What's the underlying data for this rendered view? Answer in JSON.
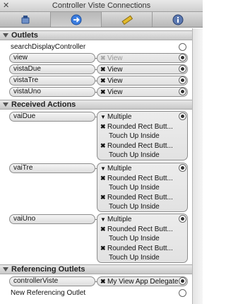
{
  "window": {
    "title": "Controller Viste Connections",
    "close_glyph": "✕"
  },
  "toolbar": {
    "tabs": [
      {
        "icon": "attributes-icon",
        "active": false
      },
      {
        "icon": "connections-arrow-icon",
        "active": true
      },
      {
        "icon": "size-ruler-icon",
        "active": false
      },
      {
        "icon": "info-icon",
        "active": false
      }
    ]
  },
  "sections": {
    "outlets": "Outlets",
    "received_actions": "Received Actions",
    "referencing_outlets": "Referencing Outlets"
  },
  "outlets": {
    "unconnected": "searchDisplayController",
    "items": [
      {
        "name": "view",
        "target": "View",
        "dimmed": true
      },
      {
        "name": "vistaDue",
        "target": "View",
        "dimmed": false
      },
      {
        "name": "vistaTre",
        "target": "View",
        "dimmed": false
      },
      {
        "name": "vistaUno",
        "target": "View",
        "dimmed": false
      }
    ]
  },
  "actions": [
    {
      "name": "vaiDue",
      "multiple": "Multiple",
      "connections": [
        {
          "source": "Rounded Rect Butt...",
          "event": "Touch Up Inside"
        },
        {
          "source": "Rounded Rect Butt...",
          "event": "Touch Up Inside"
        }
      ]
    },
    {
      "name": "vaiTre",
      "multiple": "Multiple",
      "connections": [
        {
          "source": "Rounded Rect Butt...",
          "event": "Touch Up Inside"
        },
        {
          "source": "Rounded Rect Butt...",
          "event": "Touch Up Inside"
        }
      ]
    },
    {
      "name": "vaiUno",
      "multiple": "Multiple",
      "connections": [
        {
          "source": "Rounded Rect Butt...",
          "event": "Touch Up Inside"
        },
        {
          "source": "Rounded Rect Butt...",
          "event": "Touch Up Inside"
        }
      ]
    }
  ],
  "referencing": {
    "items": [
      {
        "name": "controllerViste",
        "target": "My View App Delegate"
      }
    ],
    "new_label": "New Referencing Outlet"
  },
  "glyphs": {
    "x": "✖",
    "multiple": "▼"
  }
}
